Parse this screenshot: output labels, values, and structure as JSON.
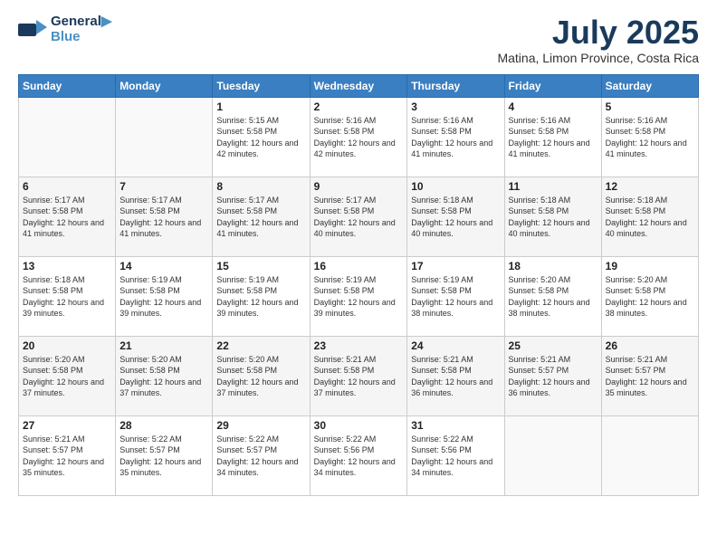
{
  "logo": {
    "line1": "General",
    "line2": "Blue"
  },
  "title": "July 2025",
  "location": "Matina, Limon Province, Costa Rica",
  "weekdays": [
    "Sunday",
    "Monday",
    "Tuesday",
    "Wednesday",
    "Thursday",
    "Friday",
    "Saturday"
  ],
  "weeks": [
    [
      {
        "day": "",
        "info": ""
      },
      {
        "day": "",
        "info": ""
      },
      {
        "day": "1",
        "info": "Sunrise: 5:15 AM\nSunset: 5:58 PM\nDaylight: 12 hours and 42 minutes."
      },
      {
        "day": "2",
        "info": "Sunrise: 5:16 AM\nSunset: 5:58 PM\nDaylight: 12 hours and 42 minutes."
      },
      {
        "day": "3",
        "info": "Sunrise: 5:16 AM\nSunset: 5:58 PM\nDaylight: 12 hours and 41 minutes."
      },
      {
        "day": "4",
        "info": "Sunrise: 5:16 AM\nSunset: 5:58 PM\nDaylight: 12 hours and 41 minutes."
      },
      {
        "day": "5",
        "info": "Sunrise: 5:16 AM\nSunset: 5:58 PM\nDaylight: 12 hours and 41 minutes."
      }
    ],
    [
      {
        "day": "6",
        "info": "Sunrise: 5:17 AM\nSunset: 5:58 PM\nDaylight: 12 hours and 41 minutes."
      },
      {
        "day": "7",
        "info": "Sunrise: 5:17 AM\nSunset: 5:58 PM\nDaylight: 12 hours and 41 minutes."
      },
      {
        "day": "8",
        "info": "Sunrise: 5:17 AM\nSunset: 5:58 PM\nDaylight: 12 hours and 41 minutes."
      },
      {
        "day": "9",
        "info": "Sunrise: 5:17 AM\nSunset: 5:58 PM\nDaylight: 12 hours and 40 minutes."
      },
      {
        "day": "10",
        "info": "Sunrise: 5:18 AM\nSunset: 5:58 PM\nDaylight: 12 hours and 40 minutes."
      },
      {
        "day": "11",
        "info": "Sunrise: 5:18 AM\nSunset: 5:58 PM\nDaylight: 12 hours and 40 minutes."
      },
      {
        "day": "12",
        "info": "Sunrise: 5:18 AM\nSunset: 5:58 PM\nDaylight: 12 hours and 40 minutes."
      }
    ],
    [
      {
        "day": "13",
        "info": "Sunrise: 5:18 AM\nSunset: 5:58 PM\nDaylight: 12 hours and 39 minutes."
      },
      {
        "day": "14",
        "info": "Sunrise: 5:19 AM\nSunset: 5:58 PM\nDaylight: 12 hours and 39 minutes."
      },
      {
        "day": "15",
        "info": "Sunrise: 5:19 AM\nSunset: 5:58 PM\nDaylight: 12 hours and 39 minutes."
      },
      {
        "day": "16",
        "info": "Sunrise: 5:19 AM\nSunset: 5:58 PM\nDaylight: 12 hours and 39 minutes."
      },
      {
        "day": "17",
        "info": "Sunrise: 5:19 AM\nSunset: 5:58 PM\nDaylight: 12 hours and 38 minutes."
      },
      {
        "day": "18",
        "info": "Sunrise: 5:20 AM\nSunset: 5:58 PM\nDaylight: 12 hours and 38 minutes."
      },
      {
        "day": "19",
        "info": "Sunrise: 5:20 AM\nSunset: 5:58 PM\nDaylight: 12 hours and 38 minutes."
      }
    ],
    [
      {
        "day": "20",
        "info": "Sunrise: 5:20 AM\nSunset: 5:58 PM\nDaylight: 12 hours and 37 minutes."
      },
      {
        "day": "21",
        "info": "Sunrise: 5:20 AM\nSunset: 5:58 PM\nDaylight: 12 hours and 37 minutes."
      },
      {
        "day": "22",
        "info": "Sunrise: 5:20 AM\nSunset: 5:58 PM\nDaylight: 12 hours and 37 minutes."
      },
      {
        "day": "23",
        "info": "Sunrise: 5:21 AM\nSunset: 5:58 PM\nDaylight: 12 hours and 37 minutes."
      },
      {
        "day": "24",
        "info": "Sunrise: 5:21 AM\nSunset: 5:58 PM\nDaylight: 12 hours and 36 minutes."
      },
      {
        "day": "25",
        "info": "Sunrise: 5:21 AM\nSunset: 5:57 PM\nDaylight: 12 hours and 36 minutes."
      },
      {
        "day": "26",
        "info": "Sunrise: 5:21 AM\nSunset: 5:57 PM\nDaylight: 12 hours and 35 minutes."
      }
    ],
    [
      {
        "day": "27",
        "info": "Sunrise: 5:21 AM\nSunset: 5:57 PM\nDaylight: 12 hours and 35 minutes."
      },
      {
        "day": "28",
        "info": "Sunrise: 5:22 AM\nSunset: 5:57 PM\nDaylight: 12 hours and 35 minutes."
      },
      {
        "day": "29",
        "info": "Sunrise: 5:22 AM\nSunset: 5:57 PM\nDaylight: 12 hours and 34 minutes."
      },
      {
        "day": "30",
        "info": "Sunrise: 5:22 AM\nSunset: 5:56 PM\nDaylight: 12 hours and 34 minutes."
      },
      {
        "day": "31",
        "info": "Sunrise: 5:22 AM\nSunset: 5:56 PM\nDaylight: 12 hours and 34 minutes."
      },
      {
        "day": "",
        "info": ""
      },
      {
        "day": "",
        "info": ""
      }
    ]
  ]
}
